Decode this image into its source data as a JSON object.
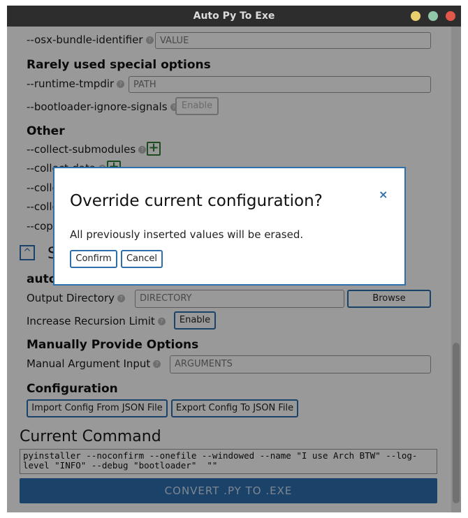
{
  "window": {
    "title": "Auto Py To Exe",
    "controls": [
      {
        "name": "minimize",
        "color": "#e8d06f"
      },
      {
        "name": "maximize",
        "color": "#8fc7a8"
      },
      {
        "name": "close",
        "color": "#e0584a"
      }
    ]
  },
  "options_top": {
    "osx_bundle": {
      "label": "--osx-bundle-identifier",
      "placeholder": "VALUE"
    }
  },
  "rarely_used": {
    "heading": "Rarely used special options",
    "runtime_tmpdir": {
      "label": "--runtime-tmpdir",
      "placeholder": "PATH"
    },
    "bootloader_ignore_signals": {
      "label": "--bootloader-ignore-signals",
      "button": "Enable"
    }
  },
  "other": {
    "heading": "Other",
    "items": [
      {
        "label": "--collect-submodules"
      },
      {
        "label": "--collect-data"
      },
      {
        "label": "--colle"
      },
      {
        "label": "--colle"
      },
      {
        "label": "--cop"
      }
    ]
  },
  "settings": {
    "collapse_icon": "chevron-up",
    "partial_heading": "S",
    "auto_heading_partial": "auto-",
    "output_directory": {
      "label": "Output Directory",
      "placeholder": "DIRECTORY",
      "browse": "Browse"
    },
    "recursion_limit": {
      "label": "Increase Recursion Limit",
      "button": "Enable"
    },
    "manual": {
      "heading": "Manually Provide Options",
      "label": "Manual Argument Input",
      "placeholder": "ARGUMENTS"
    },
    "configuration": {
      "heading": "Configuration",
      "import": "Import Config From JSON File",
      "export": "Export Config To JSON File"
    }
  },
  "current_command": {
    "heading": "Current Command",
    "text": "pyinstaller --noconfirm --onefile --windowed --name \"I use Arch BTW\" --log-level \"INFO\" --debug \"bootloader\"  \"\""
  },
  "convert_button": "CONVERT .PY TO .EXE",
  "modal": {
    "title": "Override current configuration?",
    "close": "×",
    "body": "All previously inserted values will be erased.",
    "confirm": "Confirm",
    "cancel": "Cancel"
  },
  "colors": {
    "accent": "#2d6fad",
    "add_green": "#2e7d32",
    "titlebar": "#2d2d2d"
  }
}
